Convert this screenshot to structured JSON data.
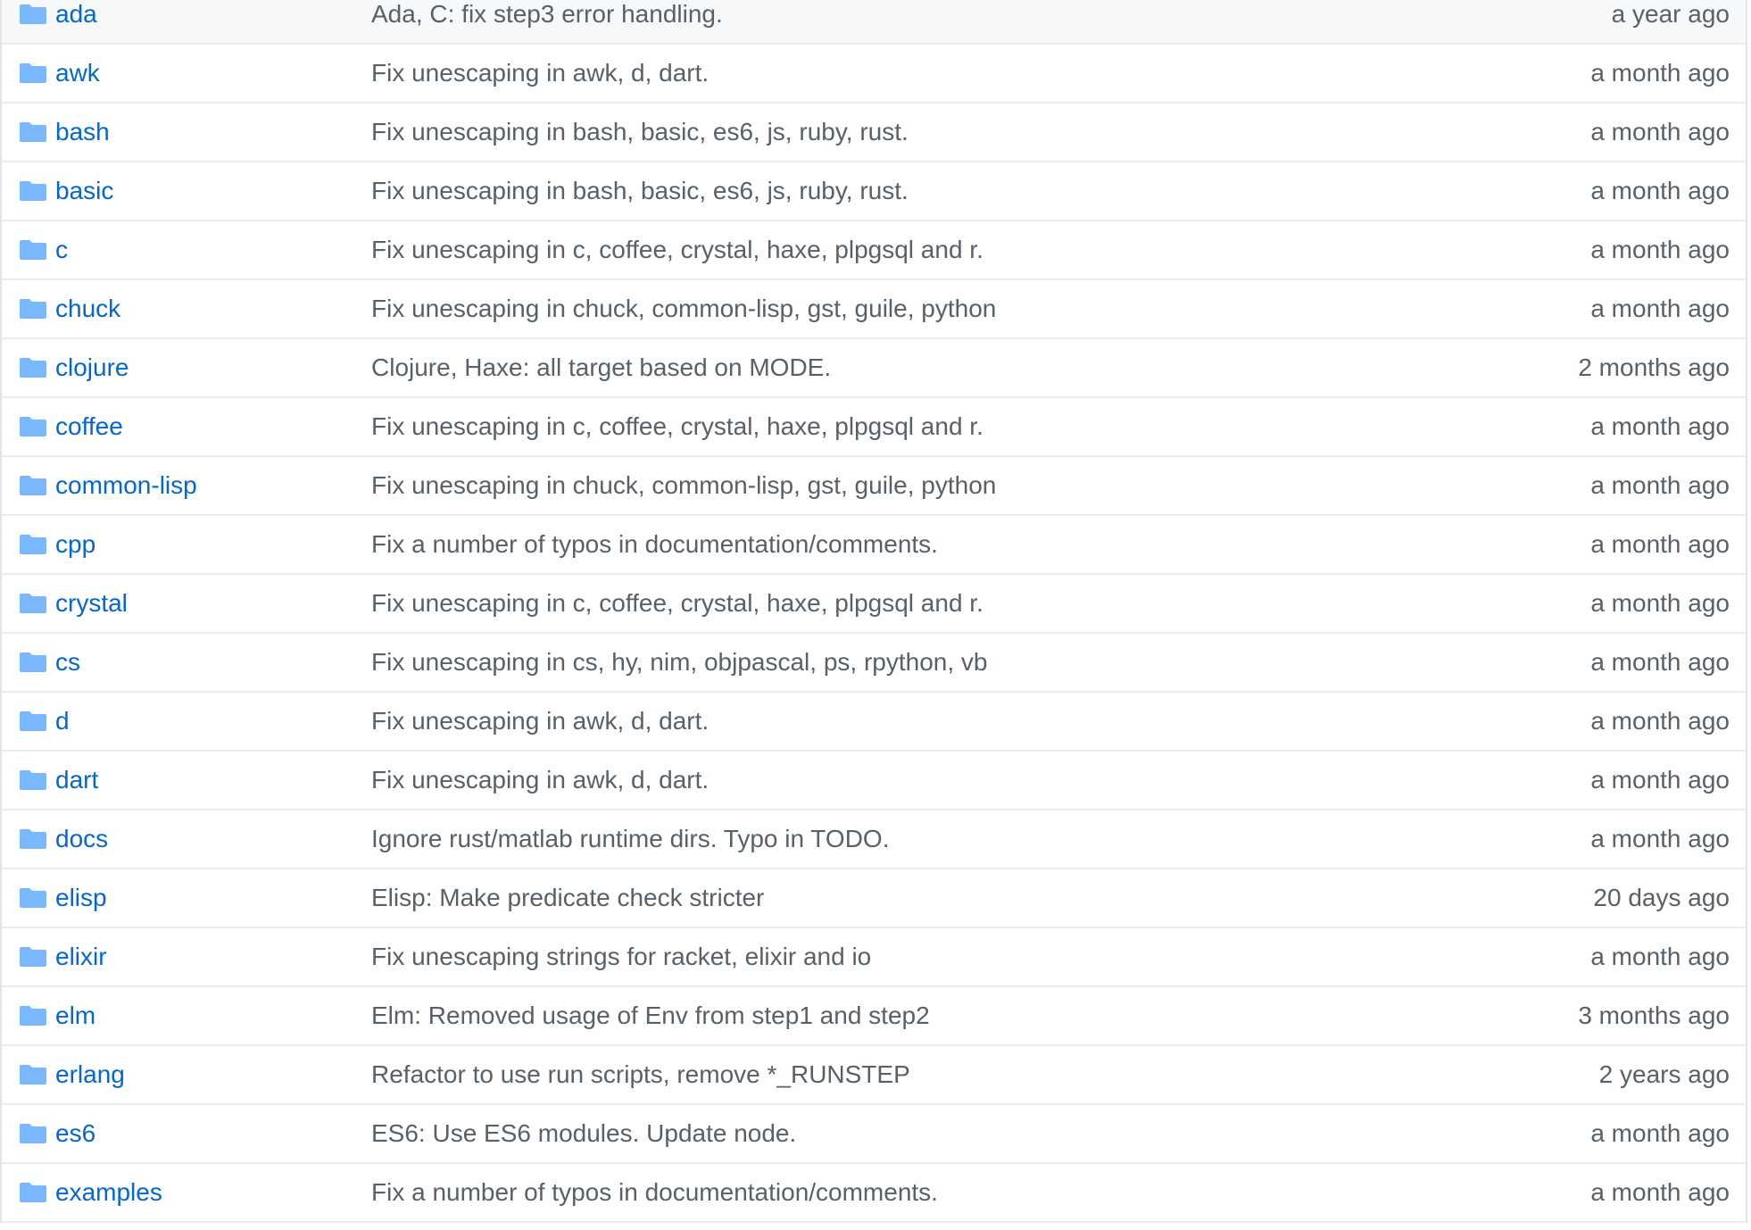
{
  "icon": "folder-icon",
  "colors": {
    "link": "#0366d6",
    "secondary_text": "#586069",
    "folder_icon": "#79b8ff",
    "border": "#eaecef",
    "first_row_bg": "#f6f8fa"
  },
  "rows": [
    {
      "name": "ada",
      "message": "Ada, C: fix step3 error handling.",
      "age": "a year ago"
    },
    {
      "name": "awk",
      "message": "Fix unescaping in awk, d, dart.",
      "age": "a month ago"
    },
    {
      "name": "bash",
      "message": "Fix unescaping in bash, basic, es6, js, ruby, rust.",
      "age": "a month ago"
    },
    {
      "name": "basic",
      "message": "Fix unescaping in bash, basic, es6, js, ruby, rust.",
      "age": "a month ago"
    },
    {
      "name": "c",
      "message": "Fix unescaping in c, coffee, crystal, haxe, plpgsql and r.",
      "age": "a month ago"
    },
    {
      "name": "chuck",
      "message": "Fix unescaping in chuck, common-lisp, gst, guile, python",
      "age": "a month ago"
    },
    {
      "name": "clojure",
      "message": "Clojure, Haxe: all target based on MODE.",
      "age": "2 months ago"
    },
    {
      "name": "coffee",
      "message": "Fix unescaping in c, coffee, crystal, haxe, plpgsql and r.",
      "age": "a month ago"
    },
    {
      "name": "common-lisp",
      "message": "Fix unescaping in chuck, common-lisp, gst, guile, python",
      "age": "a month ago"
    },
    {
      "name": "cpp",
      "message": "Fix a number of typos in documentation/comments.",
      "age": "a month ago"
    },
    {
      "name": "crystal",
      "message": "Fix unescaping in c, coffee, crystal, haxe, plpgsql and r.",
      "age": "a month ago"
    },
    {
      "name": "cs",
      "message": "Fix unescaping in cs, hy, nim, objpascal, ps, rpython, vb",
      "age": "a month ago"
    },
    {
      "name": "d",
      "message": "Fix unescaping in awk, d, dart.",
      "age": "a month ago"
    },
    {
      "name": "dart",
      "message": "Fix unescaping in awk, d, dart.",
      "age": "a month ago"
    },
    {
      "name": "docs",
      "message": "Ignore rust/matlab runtime dirs. Typo in TODO.",
      "age": "a month ago"
    },
    {
      "name": "elisp",
      "message": "Elisp: Make predicate check stricter",
      "age": "20 days ago"
    },
    {
      "name": "elixir",
      "message": "Fix unescaping strings for racket, elixir and io",
      "age": "a month ago"
    },
    {
      "name": "elm",
      "message": "Elm: Removed usage of Env from step1 and step2",
      "age": "3 months ago"
    },
    {
      "name": "erlang",
      "message": "Refactor to use run scripts, remove *_RUNSTEP",
      "age": "2 years ago"
    },
    {
      "name": "es6",
      "message": "ES6: Use ES6 modules. Update node.",
      "age": "a month ago"
    },
    {
      "name": "examples",
      "message": "Fix a number of typos in documentation/comments.",
      "age": "a month ago"
    }
  ]
}
